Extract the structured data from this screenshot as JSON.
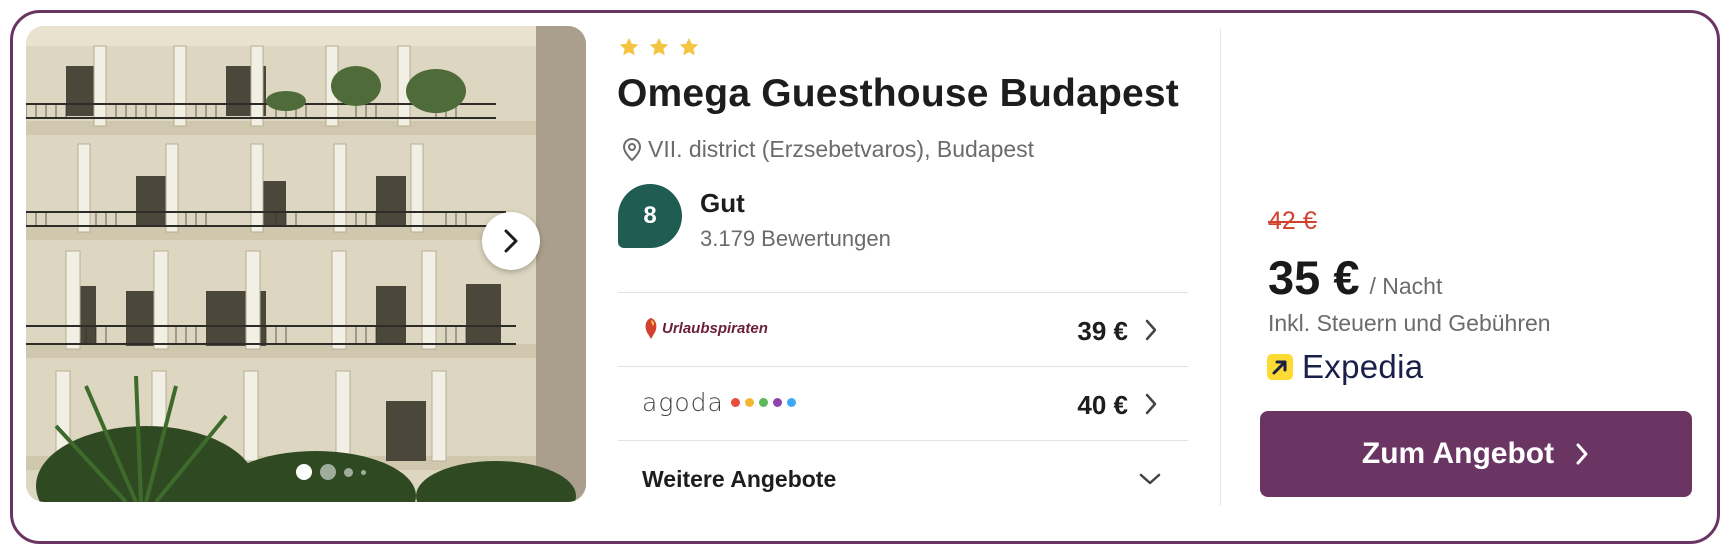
{
  "hotel": {
    "name": "Omega Guesthouse Budapest",
    "stars": 3,
    "location": "VII. district (Erzsebetvaros), Budapest",
    "rating": {
      "score": "8",
      "label": "Gut",
      "reviews": "3.179 Bewertungen"
    }
  },
  "gallery": {
    "image_count_dots": 4,
    "active_index": 0
  },
  "offers": [
    {
      "provider": "Urlaubspiraten",
      "price": "39 €"
    },
    {
      "provider": "agoda",
      "price": "40 €"
    }
  ],
  "more_offers_label": "Weitere Angebote",
  "deal": {
    "old_price": "42 €",
    "price": "35 €",
    "per_night": "/ Nacht",
    "tax_note": "Inkl. Steuern und Gebühren",
    "provider": "Expedia",
    "cta_label": "Zum Angebot"
  },
  "colors": {
    "brand": "#6b3563",
    "rating_badge": "#1f5c52",
    "star": "#f4c542",
    "old_price": "#d2412f",
    "agoda_dots": [
      "#e74c3c",
      "#f5b731",
      "#5cb85c",
      "#8e44ad",
      "#3fa9f5"
    ]
  }
}
